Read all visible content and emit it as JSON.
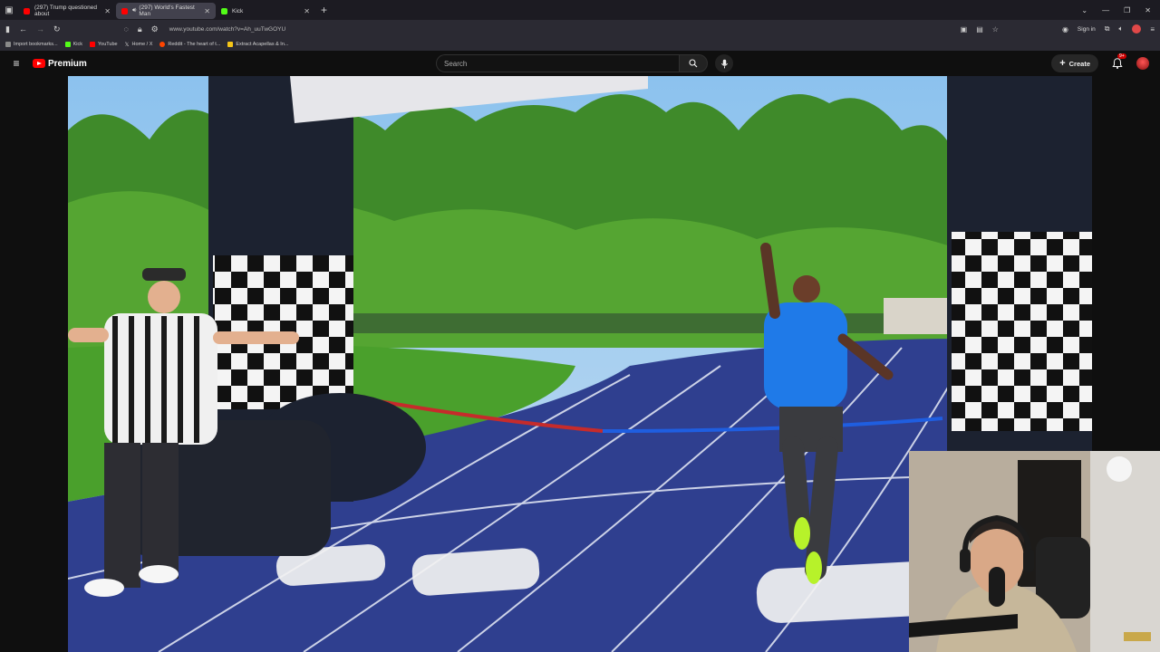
{
  "browser": {
    "tabs": [
      {
        "title": "(297) Trump questioned about",
        "favicon_color": "#ff0000",
        "active": false
      },
      {
        "title": "(297) World's Fastest Man",
        "favicon_color": "#ff0000",
        "active": true,
        "audio": true
      },
      {
        "title": "Kick",
        "favicon_color": "#53fc18",
        "active": false
      }
    ],
    "url": "www.youtube.com/watch?v=Ah_uuTwGOYU",
    "sign_in": "Sign in",
    "bookmarks": [
      {
        "label": "Import bookmarks...",
        "color": "#8a8a8a"
      },
      {
        "label": "Kick",
        "color": "#53fc18"
      },
      {
        "label": "YouTube",
        "color": "#ff0000"
      },
      {
        "label": "Home / X",
        "color": "#ffffff"
      },
      {
        "label": "Reddit - The heart of t...",
        "color": "#ff4500"
      },
      {
        "label": "Extract Acapellas & In...",
        "color": "#f5c518"
      }
    ]
  },
  "youtube": {
    "logo_text": "Premium",
    "search_placeholder": "Search",
    "create_label": "Create",
    "notification_count": "9+"
  },
  "colors": {
    "brand_red": "#ff0000",
    "track_blue": "#2f3f8f",
    "sky": "#9cc8ef",
    "grass": "#4aa02c"
  }
}
